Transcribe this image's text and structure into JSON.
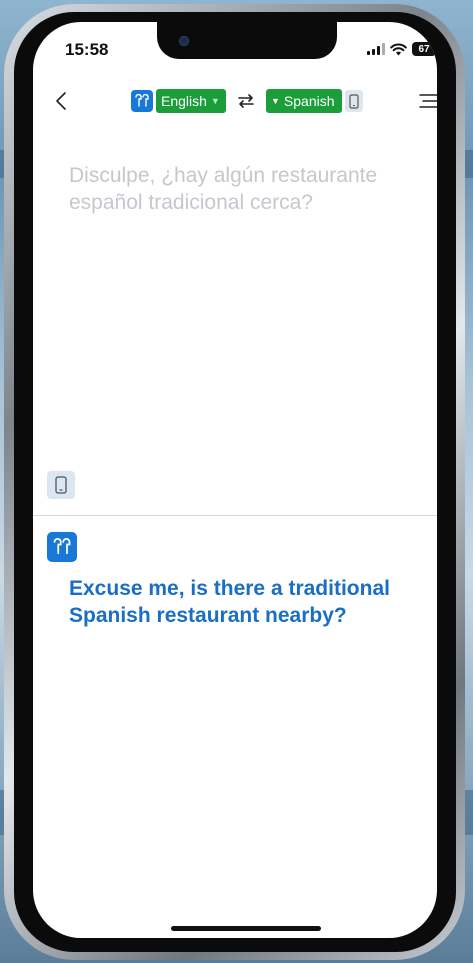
{
  "status_bar": {
    "time": "15:58",
    "battery_level": "67",
    "icons": [
      "cellular-signal-icon",
      "wifi-icon",
      "battery-icon"
    ]
  },
  "toolbar": {
    "source_language": "English",
    "target_language": "Spanish",
    "icons": [
      "back-chevron-icon",
      "earbuds-icon",
      "swap-icon",
      "phone-icon",
      "menu-icon"
    ],
    "accent_color": "#1b9e3a"
  },
  "translation": {
    "source_text": "Disculpe, ¿hay algún restaurante español tradicional cerca?",
    "target_text": "Excuse me, is there a traditional Spanish restaurant nearby?",
    "target_color": "#1a6fc4",
    "source_color": "#c4c8cd"
  }
}
